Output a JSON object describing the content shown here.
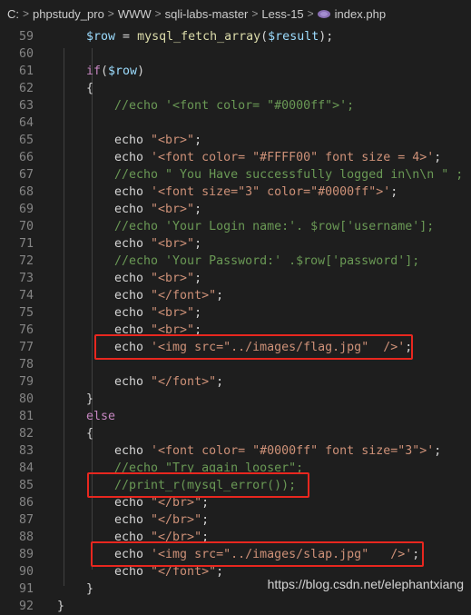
{
  "breadcrumb": {
    "items": [
      "C:",
      "phpstudy_pro",
      "WWW",
      "sqli-labs-master",
      "Less-15",
      "index.php"
    ],
    "separator": ">"
  },
  "lines": [
    {
      "n": "59",
      "indent": 1,
      "tokens": [
        [
          "var",
          "$row"
        ],
        [
          "txt",
          " = "
        ],
        [
          "fn",
          "mysql_fetch_array"
        ],
        [
          "txt",
          "("
        ],
        [
          "var",
          "$result"
        ],
        [
          "txt",
          ");"
        ]
      ]
    },
    {
      "n": "60",
      "indent": 0,
      "tokens": []
    },
    {
      "n": "61",
      "indent": 1,
      "tokens": [
        [
          "kw",
          "if"
        ],
        [
          "txt",
          "("
        ],
        [
          "var",
          "$row"
        ],
        [
          "txt",
          ")"
        ]
      ]
    },
    {
      "n": "62",
      "indent": 1,
      "tokens": [
        [
          "txt",
          "{"
        ]
      ]
    },
    {
      "n": "63",
      "indent": 2,
      "tokens": [
        [
          "cm",
          "//echo '<font color= \"#0000ff\">';"
        ]
      ]
    },
    {
      "n": "64",
      "indent": 0,
      "tokens": []
    },
    {
      "n": "65",
      "indent": 2,
      "tokens": [
        [
          "txt",
          "echo "
        ],
        [
          "str",
          "\"<br>\""
        ],
        [
          "txt",
          ";"
        ]
      ]
    },
    {
      "n": "66",
      "indent": 2,
      "tokens": [
        [
          "txt",
          "echo "
        ],
        [
          "str",
          "'<font color= \"#FFFF00\" font size = 4>'"
        ],
        [
          "txt",
          ";"
        ]
      ]
    },
    {
      "n": "67",
      "indent": 2,
      "tokens": [
        [
          "cm",
          "//echo \" You Have successfully logged in\\n\\n \" ;"
        ]
      ]
    },
    {
      "n": "68",
      "indent": 2,
      "tokens": [
        [
          "txt",
          "echo "
        ],
        [
          "str",
          "'<font size=\"3\" color=\"#0000ff\">'"
        ],
        [
          "txt",
          ";"
        ]
      ]
    },
    {
      "n": "69",
      "indent": 2,
      "tokens": [
        [
          "txt",
          "echo "
        ],
        [
          "str",
          "\"<br>\""
        ],
        [
          "txt",
          ";"
        ]
      ]
    },
    {
      "n": "70",
      "indent": 2,
      "tokens": [
        [
          "cm",
          "//echo 'Your Login name:'. $row['username'];"
        ]
      ]
    },
    {
      "n": "71",
      "indent": 2,
      "tokens": [
        [
          "txt",
          "echo "
        ],
        [
          "str",
          "\"<br>\""
        ],
        [
          "txt",
          ";"
        ]
      ]
    },
    {
      "n": "72",
      "indent": 2,
      "tokens": [
        [
          "cm",
          "//echo 'Your Password:' .$row['password'];"
        ]
      ]
    },
    {
      "n": "73",
      "indent": 2,
      "tokens": [
        [
          "txt",
          "echo "
        ],
        [
          "str",
          "\"<br>\""
        ],
        [
          "txt",
          ";"
        ]
      ]
    },
    {
      "n": "74",
      "indent": 2,
      "tokens": [
        [
          "txt",
          "echo "
        ],
        [
          "str",
          "\"</font>\""
        ],
        [
          "txt",
          ";"
        ]
      ]
    },
    {
      "n": "75",
      "indent": 2,
      "tokens": [
        [
          "txt",
          "echo "
        ],
        [
          "str",
          "\"<br>\""
        ],
        [
          "txt",
          ";"
        ]
      ]
    },
    {
      "n": "76",
      "indent": 2,
      "tokens": [
        [
          "txt",
          "echo "
        ],
        [
          "str",
          "\"<br>\""
        ],
        [
          "txt",
          ";"
        ]
      ]
    },
    {
      "n": "77",
      "indent": 2,
      "tokens": [
        [
          "txt",
          "echo "
        ],
        [
          "str",
          "'<img src=\"../images/flag.jpg\"  />'"
        ],
        [
          "txt",
          ";"
        ]
      ]
    },
    {
      "n": "78",
      "indent": 0,
      "tokens": []
    },
    {
      "n": "79",
      "indent": 2,
      "tokens": [
        [
          "txt",
          "echo "
        ],
        [
          "str",
          "\"</font>\""
        ],
        [
          "txt",
          ";"
        ]
      ]
    },
    {
      "n": "80",
      "indent": 1,
      "tokens": [
        [
          "txt",
          "}"
        ]
      ]
    },
    {
      "n": "81",
      "indent": 1,
      "tokens": [
        [
          "kw",
          "else"
        ]
      ]
    },
    {
      "n": "82",
      "indent": 1,
      "tokens": [
        [
          "txt",
          "{"
        ]
      ]
    },
    {
      "n": "83",
      "indent": 2,
      "tokens": [
        [
          "txt",
          "echo "
        ],
        [
          "str",
          "'<font color= \"#0000ff\" font size=\"3\">'"
        ],
        [
          "txt",
          ";"
        ]
      ]
    },
    {
      "n": "84",
      "indent": 2,
      "tokens": [
        [
          "cm",
          "//echo \"Try again looser\";"
        ]
      ]
    },
    {
      "n": "85",
      "indent": 2,
      "tokens": [
        [
          "cm",
          "//print_r(mysql_error());"
        ]
      ]
    },
    {
      "n": "86",
      "indent": 2,
      "tokens": [
        [
          "txt",
          "echo "
        ],
        [
          "str",
          "\"</br>\""
        ],
        [
          "txt",
          ";"
        ]
      ]
    },
    {
      "n": "87",
      "indent": 2,
      "tokens": [
        [
          "txt",
          "echo "
        ],
        [
          "str",
          "\"</br>\""
        ],
        [
          "txt",
          ";"
        ]
      ]
    },
    {
      "n": "88",
      "indent": 2,
      "tokens": [
        [
          "txt",
          "echo "
        ],
        [
          "str",
          "\"</br>\""
        ],
        [
          "txt",
          ";"
        ]
      ]
    },
    {
      "n": "89",
      "indent": 2,
      "tokens": [
        [
          "txt",
          "echo "
        ],
        [
          "str",
          "'<img src=\"../images/slap.jpg\"   />'"
        ],
        [
          "txt",
          ";"
        ]
      ]
    },
    {
      "n": "90",
      "indent": 2,
      "tokens": [
        [
          "txt",
          "echo "
        ],
        [
          "str",
          "\"</font>\""
        ],
        [
          "txt",
          ";"
        ]
      ]
    },
    {
      "n": "91",
      "indent": 1,
      "tokens": [
        [
          "txt",
          "}"
        ]
      ]
    },
    {
      "n": "92",
      "indent": 0,
      "tokens": [
        [
          "txt",
          "}"
        ]
      ]
    }
  ],
  "highlighted_lines": [
    "77",
    "85",
    "89"
  ],
  "watermark": "https://blog.csdn.net/elephantxiang",
  "colors": {
    "background": "#1e1e1e",
    "line_number": "#858585",
    "variable": "#9cdcfe",
    "function": "#dcdcaa",
    "keyword": "#c586c0",
    "string": "#ce9178",
    "comment": "#6a9955",
    "highlight_box": "#e8271f"
  }
}
